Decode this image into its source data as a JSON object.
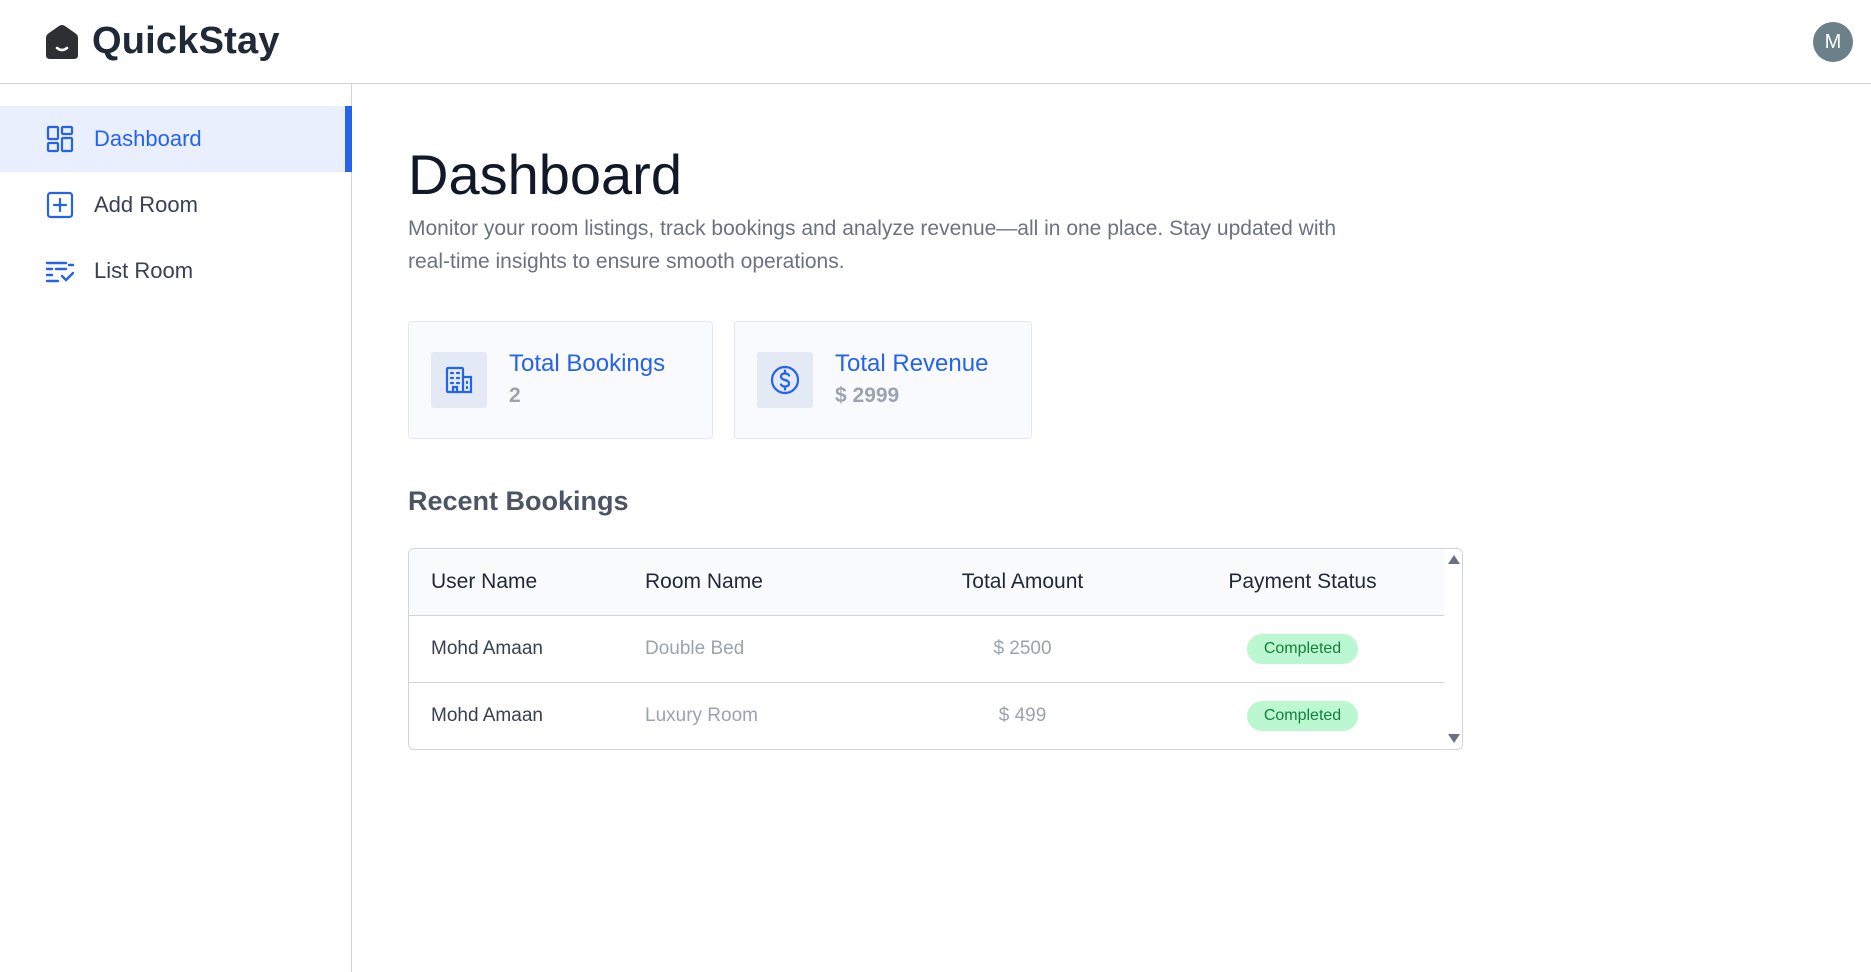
{
  "app": {
    "brand": "QuickStay",
    "avatar_initial": "M"
  },
  "sidebar": {
    "items": [
      {
        "label": "Dashboard",
        "icon": "dashboard-icon",
        "active": true
      },
      {
        "label": "Add Room",
        "icon": "add-square-icon",
        "active": false
      },
      {
        "label": "List Room",
        "icon": "list-check-icon",
        "active": false
      }
    ]
  },
  "main": {
    "title": "Dashboard",
    "description": "Monitor your room listings, track bookings and analyze revenue—all in one place. Stay updated with real-time insights to ensure smooth operations.",
    "cards": {
      "bookings": {
        "label": "Total Bookings",
        "value": "2",
        "icon": "building-icon"
      },
      "revenue": {
        "label": "Total Revenue",
        "value": "$ 2999",
        "icon": "dollar-circle-icon"
      }
    },
    "recent_title": "Recent Bookings",
    "table": {
      "headers": [
        "User Name",
        "Room Name",
        "Total Amount",
        "Payment Status"
      ],
      "rows": [
        {
          "user": "Mohd Amaan",
          "room": "Double Bed",
          "amount": "$ 2500",
          "status": "Completed"
        },
        {
          "user": "Mohd Amaan",
          "room": "Luxury Room",
          "amount": "$ 499",
          "status": "Completed"
        }
      ]
    }
  },
  "colors": {
    "accent": "#2563eb",
    "active_bg": "#e9effd",
    "status_bg": "#bbf7d0",
    "status_text": "#15803d"
  }
}
